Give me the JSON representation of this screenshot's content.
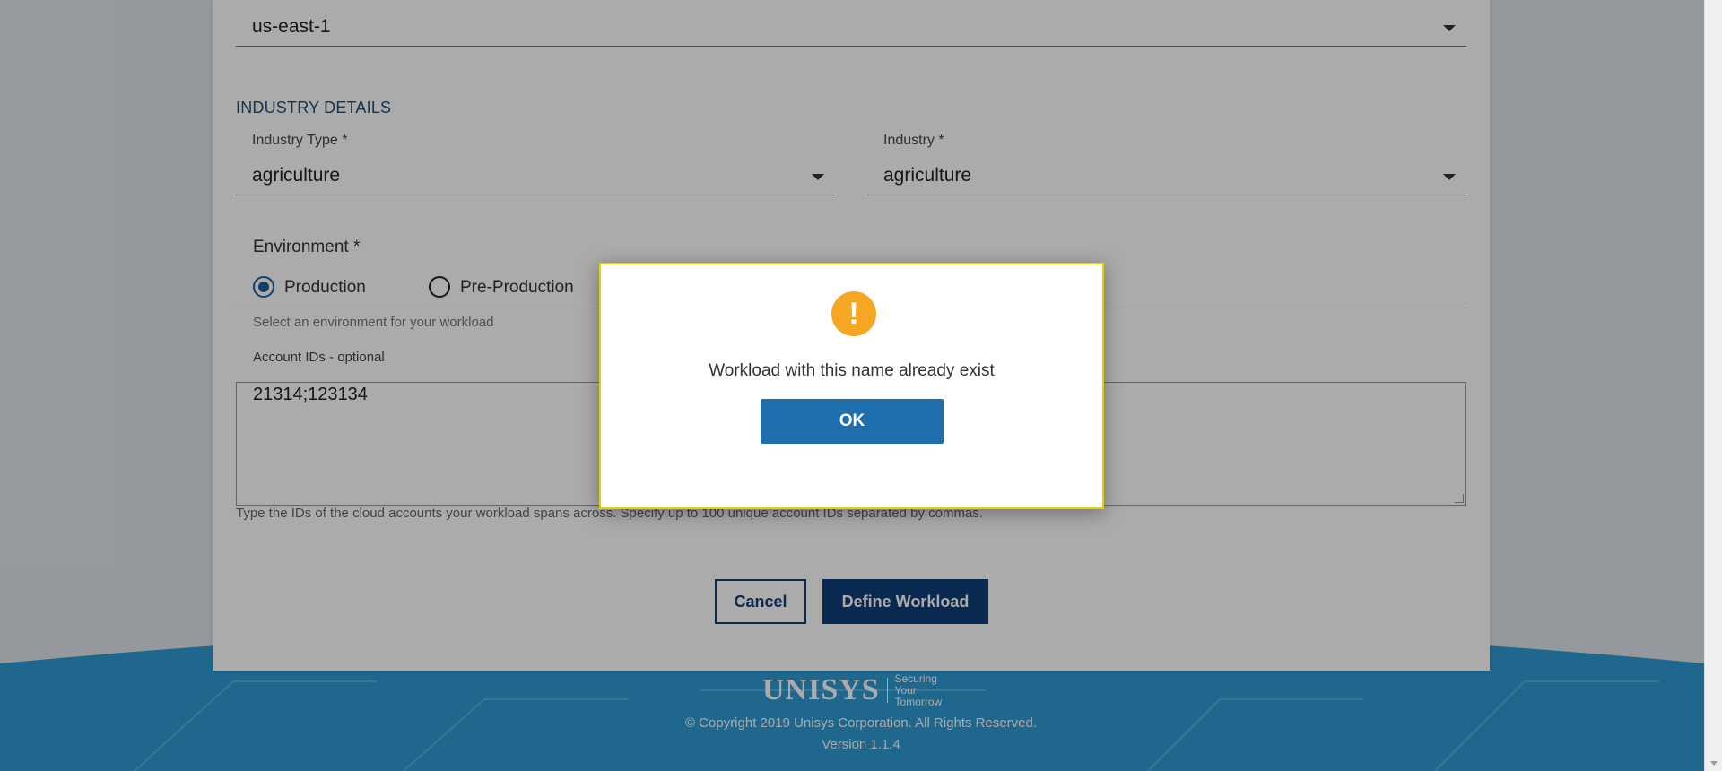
{
  "region": {
    "value": "us-east-1"
  },
  "industry_section": {
    "title": "INDUSTRY DETAILS"
  },
  "industry_type": {
    "label": "Industry Type *",
    "value": "agriculture"
  },
  "industry": {
    "label": "Industry *",
    "value": "agriculture"
  },
  "environment": {
    "label": "Environment *",
    "options": [
      {
        "label": "Production",
        "selected": true
      },
      {
        "label": "Pre-Production",
        "selected": false
      }
    ],
    "helper": "Select an environment for your workload"
  },
  "account_ids": {
    "label": "Account IDs - optional",
    "value": "21314;123134",
    "helper": "Type the IDs of the cloud accounts your workload spans across. Specify up to 100 unique account IDs separated by commas."
  },
  "actions": {
    "cancel_label": "Cancel",
    "define_label": "Define Workload"
  },
  "footer": {
    "brand": "UNISYS",
    "tagline_line1": "Securing Your",
    "tagline_line2": "Tomorrow",
    "copyright": "© Copyright 2019 Unisys Corporation. All Rights Reserved.",
    "version": "Version 1.1.4"
  },
  "dialog": {
    "icon": "warning-icon",
    "icon_glyph": "!",
    "message": "Workload with this name already exist",
    "ok_label": "OK",
    "border_color": "#e3d200",
    "icon_color": "#f5a623"
  },
  "colors": {
    "primary": "#0f3e78",
    "footer_blue": "#2f9ad2",
    "section_title": "#1f4f78"
  }
}
